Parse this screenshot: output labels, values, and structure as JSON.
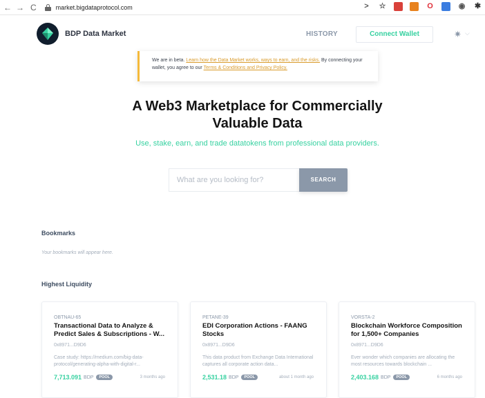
{
  "browser": {
    "back": "←",
    "forward": "→",
    "reload": "C",
    "url": "market.bigdataprotocol.com",
    "extensions": [
      {
        "name": "cast-icon",
        "glyph": ">",
        "color": "#555"
      },
      {
        "name": "star-icon",
        "glyph": "☆",
        "color": "#555"
      },
      {
        "name": "ext-red-icon",
        "glyph": "",
        "color": "#d9413a"
      },
      {
        "name": "ext-metamask-icon",
        "glyph": "",
        "color": "#e8821e"
      },
      {
        "name": "opera-icon",
        "glyph": "O",
        "color": "#e0303a"
      },
      {
        "name": "ext-blue-icon",
        "glyph": "",
        "color": "#3b7de0"
      },
      {
        "name": "ext-record-icon",
        "glyph": "◉",
        "color": "#555"
      },
      {
        "name": "puzzle-icon",
        "glyph": "✱",
        "color": "#333"
      }
    ]
  },
  "header": {
    "brand": "BDP Data Market",
    "history": "HISTORY",
    "connect_wallet": "Connect Wallet",
    "gear_glyph": "✷",
    "chevron_glyph": "⌵"
  },
  "banner": {
    "prefix": "We are in beta. ",
    "link1": "Learn how the Data Market works, ways to earn, and the risks.",
    "middle": " By connecting your wallet, you agree to our ",
    "link2": "Terms & Conditions and Privacy Policy."
  },
  "hero": {
    "title": "A Web3 Marketplace for Commercially Valuable Data",
    "subtitle": "Use, stake, earn, and trade datatokens from professional data providers."
  },
  "search": {
    "placeholder": "What are you looking for?",
    "button": "SEARCH"
  },
  "bookmarks": {
    "heading": "Bookmarks",
    "empty": "Your bookmarks will appear here."
  },
  "liquidity": {
    "heading": "Highest Liquidity",
    "cards": [
      {
        "symbol": "OBTNAU-65",
        "title": "Transactional Data to Analyze & Predict Sales & Subscriptions - W...",
        "owner": "0x8971...D9D6",
        "desc": "Case study: https://medium.com/big-data-protocol/generating-alpha-with-digital-r...",
        "price": "7,713.091",
        "unit": "BDP",
        "pool": "POOL",
        "age": "3 months ago"
      },
      {
        "symbol": "PETANE-39",
        "title": "EDI Corporation Actions - FAANG Stocks",
        "owner": "0x8971...D9D6",
        "desc": "This data product from Exchange Data International captures all corporate action data...",
        "price": "2,531.18",
        "unit": "BDP",
        "pool": "POOL",
        "age": "about 1 month ago"
      },
      {
        "symbol": "VORSTA-2",
        "title": "Blockchain Workforce Composition for 1,500+ Companies",
        "owner": "0x8971...D9D6",
        "desc": "Ever wonder which companies are allocating the most resources towards blockchain ...",
        "price": "2,403.168",
        "unit": "BDP",
        "pool": "POOL",
        "age": "6 months ago"
      }
    ]
  },
  "colors": {
    "accent": "#36d1a0",
    "muted": "#8b98a9",
    "banner_border": "#f5b93a"
  }
}
